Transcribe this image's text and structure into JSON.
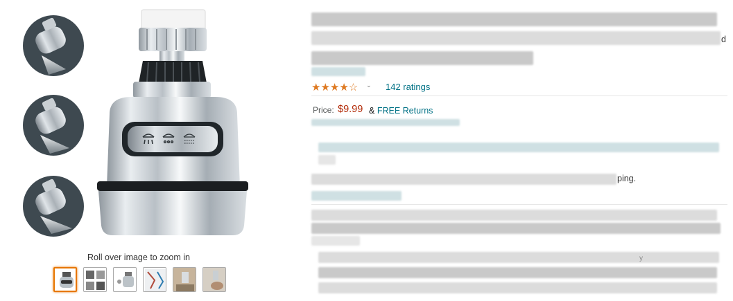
{
  "product": {
    "rating": {
      "stars": 4.0,
      "ratings_text": "142 ratings"
    },
    "price": {
      "label": "Price:",
      "value": "$9.99",
      "amp": "&",
      "returns": "FREE Returns"
    },
    "fragments": {
      "title_end": "d",
      "bullet_end": "ping.",
      "bullet_end2": "y"
    }
  },
  "gallery": {
    "zoom_hint": "Roll over image to zoom in",
    "thumbnail_count": 6,
    "selected_index": 0
  },
  "colors": {
    "star": "#de7921",
    "link": "#007185",
    "price": "#b12704",
    "selected_thumb": "#e77600"
  },
  "icons": {
    "rating_chevron": "chevron-down-icon",
    "shower_modes": [
      "rain-spray-icon",
      "shower-spray-icon",
      "mist-spray-icon"
    ]
  }
}
